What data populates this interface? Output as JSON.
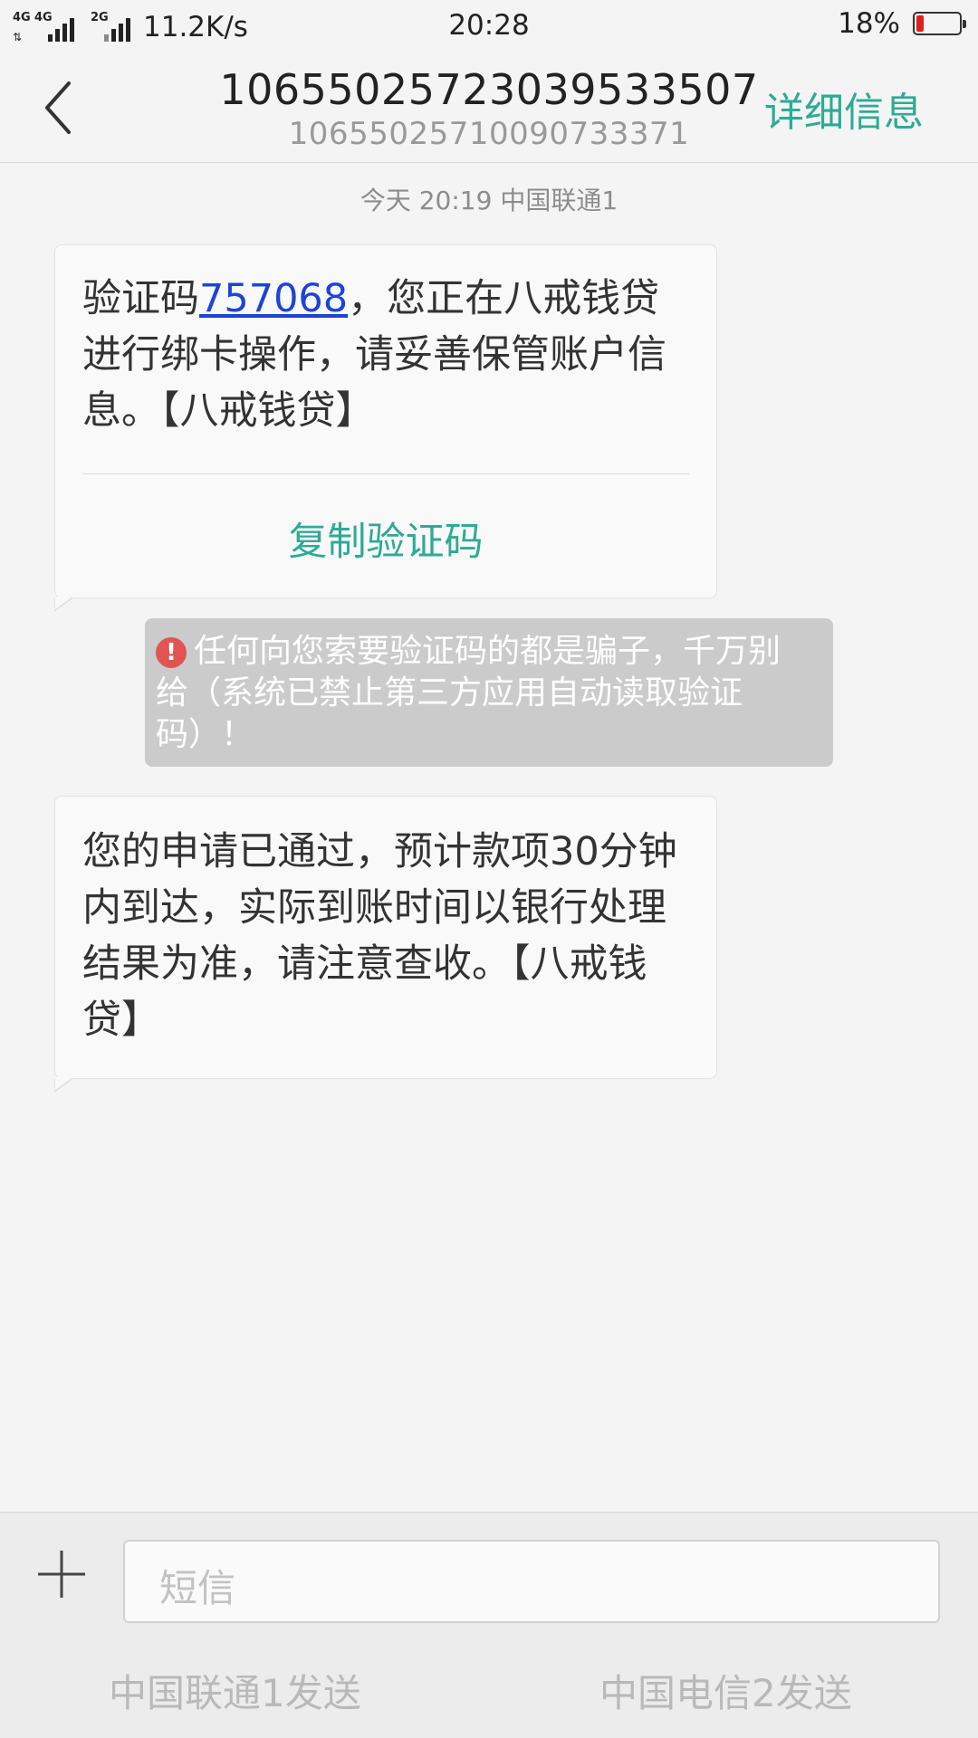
{
  "status_bar": {
    "net1_label": "4G",
    "net2_label": "4G",
    "net3_label": "2G",
    "speed": "11.2K/s",
    "time": "20:28",
    "battery": "18%",
    "battery_level": 0.18,
    "battery_color": "#e02020"
  },
  "header": {
    "back_icon": "chevron-left-icon",
    "title": "10655025723039533507",
    "subtitle": "10655025710090733371",
    "details_label": "详细信息"
  },
  "conversation": {
    "timestamp": "今天  20:19  中国联通1",
    "messages": [
      {
        "text_before": "验证码",
        "code": "757068",
        "text_after": "，您正在八戒钱贷进行绑卡操作，请妥善保管账户信息。【八戒钱贷】",
        "action_label": "复制验证码"
      },
      {
        "text": "您的申请已通过，预计款项30分钟内到达，实际到账时间以银行处理结果为准，请注意查收。【八戒钱贷】"
      }
    ],
    "warning": {
      "icon": "alert-circle-icon",
      "icon_glyph": "!",
      "text": "任何向您索要验证码的都是骗子，千万别给（系统已禁止第三方应用自动读取验证码）！"
    }
  },
  "composer": {
    "plus_icon": "plus-icon",
    "placeholder": "短信",
    "send_sim1": "中国联通1发送",
    "send_sim2": "中国电信2发送"
  },
  "colors": {
    "accent": "#2eaa95",
    "link": "#1d43d8",
    "warning_bg": "#cbcbcb",
    "warning_icon": "#e05454"
  }
}
